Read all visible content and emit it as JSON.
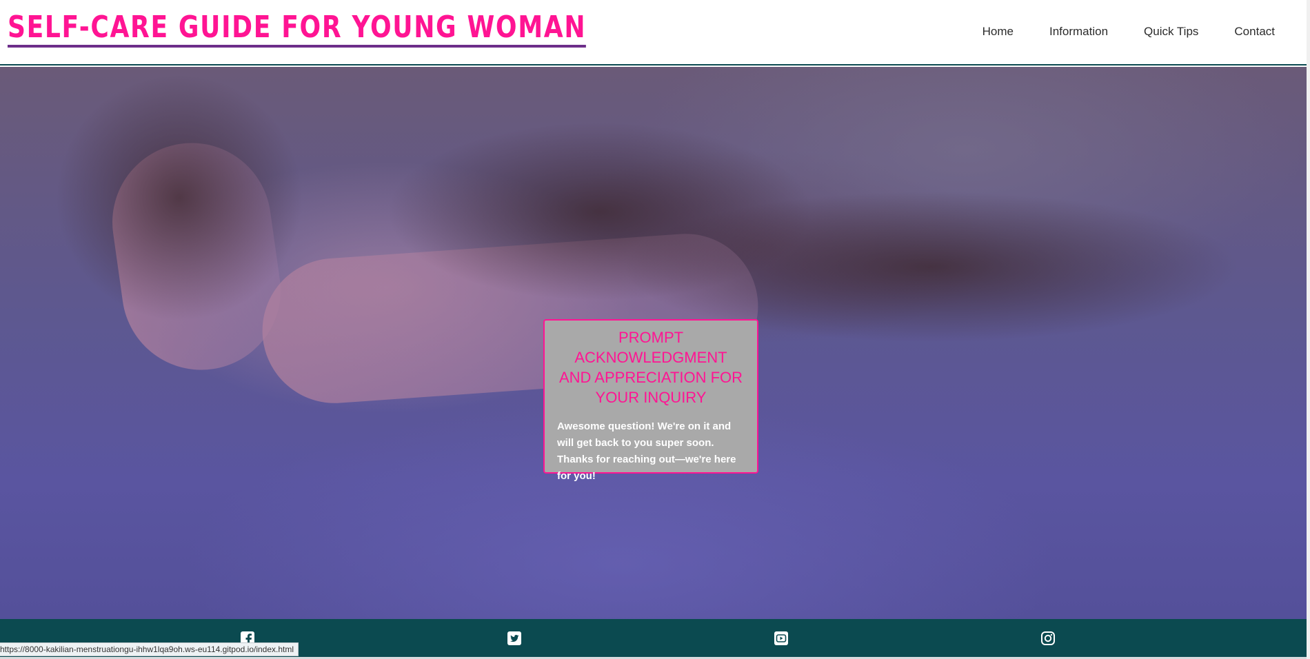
{
  "header": {
    "site_title": "SELF-CARE GUIDE FOR YOUNG WOMAN",
    "nav": [
      {
        "label": "Home"
      },
      {
        "label": "Information"
      },
      {
        "label": "Quick Tips"
      },
      {
        "label": "Contact"
      }
    ]
  },
  "modal": {
    "title": "PROMPT ACKNOWLEDGMENT AND APPRECIATION FOR YOUR INQUIRY",
    "text": "Awesome question! We're on it and will get back to you super soon. Thanks for reaching out—we're here for you!"
  },
  "footer": {
    "social_icons": [
      "facebook-icon",
      "twitter-icon",
      "youtube-icon",
      "instagram-icon"
    ]
  },
  "status_bar": {
    "url": "https://8000-kakilian-menstruationgu-ihhw1lqa9oh.ws-eu114.gitpod.io/index.html"
  },
  "colors": {
    "brand_pink": "#ff1493",
    "underline_purple": "#6d2e8a",
    "footer_teal": "#0b4a50",
    "modal_gray": "#a9a9a9"
  }
}
